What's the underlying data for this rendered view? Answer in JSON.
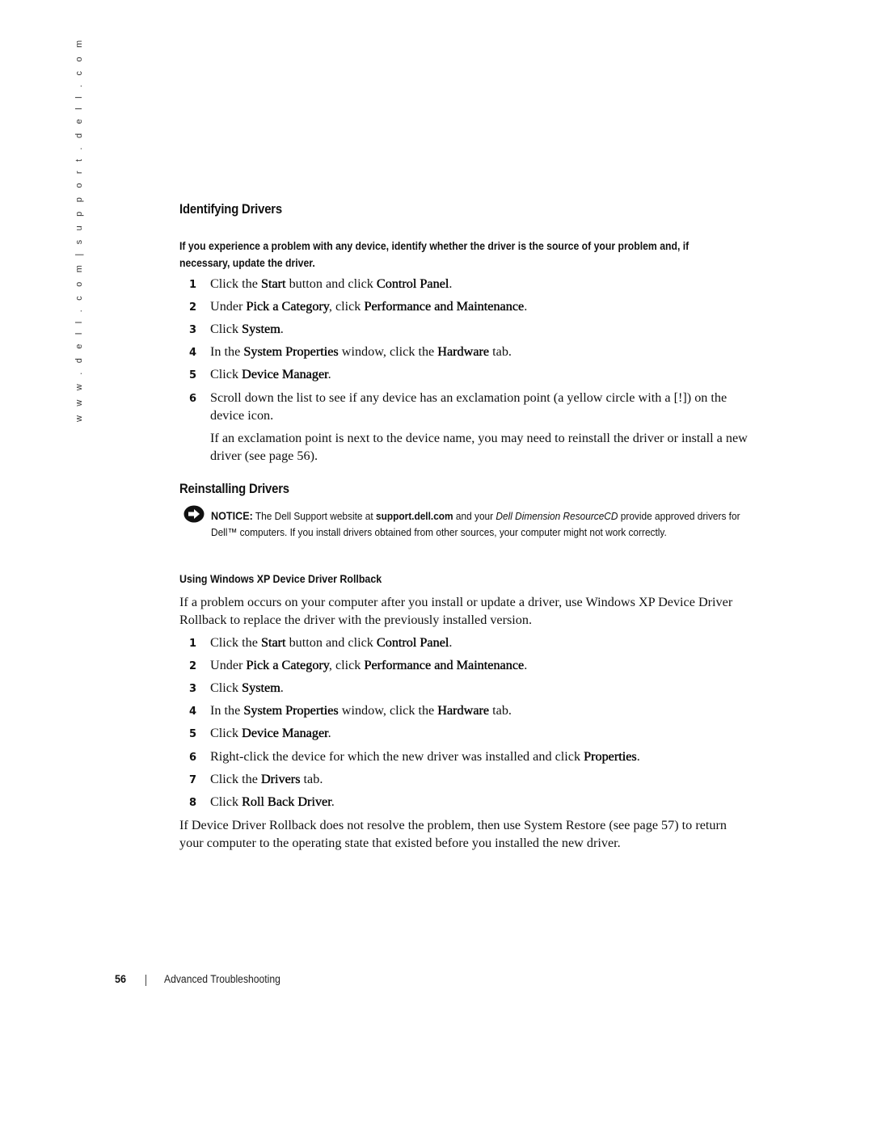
{
  "sidebar": {
    "url_text": "w w w . d e l l . c o m  |  s u p p o r t . d e l l . c o m"
  },
  "identifying": {
    "heading": "Identifying Drivers",
    "intro": "If you experience a problem with any device, identify whether the driver is the source of your problem and, if necessary, update the driver.",
    "steps": [
      {
        "num": "1",
        "parts": [
          "Click the ",
          "Start",
          " button and click ",
          "Control Panel",
          "."
        ]
      },
      {
        "num": "2",
        "parts": [
          "Under ",
          "Pick a Category",
          ", click ",
          "Performance and Maintenance",
          "."
        ]
      },
      {
        "num": "3",
        "parts": [
          "Click ",
          "System",
          "."
        ]
      },
      {
        "num": "4",
        "parts": [
          "In the ",
          "System Properties",
          " window, click the ",
          "Hardware",
          " tab."
        ]
      },
      {
        "num": "5",
        "parts": [
          "Click ",
          "Device Manager",
          "."
        ]
      },
      {
        "num": "6",
        "parts": [
          "Scroll down the list to see if any device has an exclamation point (a yellow circle with a [!]) on the device icon."
        ]
      }
    ],
    "followup": "If an exclamation point is next to the device name, you may need to reinstall the driver or install a new driver (see page 56)."
  },
  "reinstalling": {
    "heading": "Reinstalling Drivers",
    "notice": {
      "icon": "notice-arrow-icon",
      "label": "NOTICE:",
      "text_1": " The Dell Support website at ",
      "link": "support.dell.com",
      "text_2": " and your ",
      "italic": "Dell Dimension ResourceCD",
      "text_3": " provide approved drivers for Dell™ computers. If you install drivers obtained from other sources, your computer might not work correctly."
    },
    "subheading": "Using Windows XP Device Driver Rollback",
    "intro": "If a problem occurs on your computer after you install or update a driver, use Windows XP Device Driver Rollback to replace the driver with the previously installed version.",
    "steps": [
      {
        "num": "1",
        "parts": [
          "Click the ",
          "Start",
          " button and click ",
          "Control Panel",
          "."
        ]
      },
      {
        "num": "2",
        "parts": [
          "Under ",
          "Pick a Category",
          ", click ",
          "Performance and Maintenance",
          "."
        ]
      },
      {
        "num": "3",
        "parts": [
          "Click ",
          "System",
          "."
        ]
      },
      {
        "num": "4",
        "parts": [
          "In the ",
          "System Properties",
          " window, click the ",
          "Hardware",
          " tab."
        ]
      },
      {
        "num": "5",
        "parts": [
          "Click ",
          "Device Manager",
          "."
        ]
      },
      {
        "num": "6",
        "parts": [
          "Right-click the device for which the new driver was installed and click ",
          "Properties",
          "."
        ]
      },
      {
        "num": "7",
        "parts": [
          "Click the ",
          "Drivers",
          " tab."
        ]
      },
      {
        "num": "8",
        "parts": [
          "Click ",
          "Roll Back Driver",
          "."
        ]
      }
    ],
    "closing": "If Device Driver Rollback does not resolve the problem, then use System Restore (see page 57) to return your computer to the operating state that existed before you installed the new driver."
  },
  "footer": {
    "page_number": "56",
    "section_title": "Advanced Troubleshooting"
  }
}
